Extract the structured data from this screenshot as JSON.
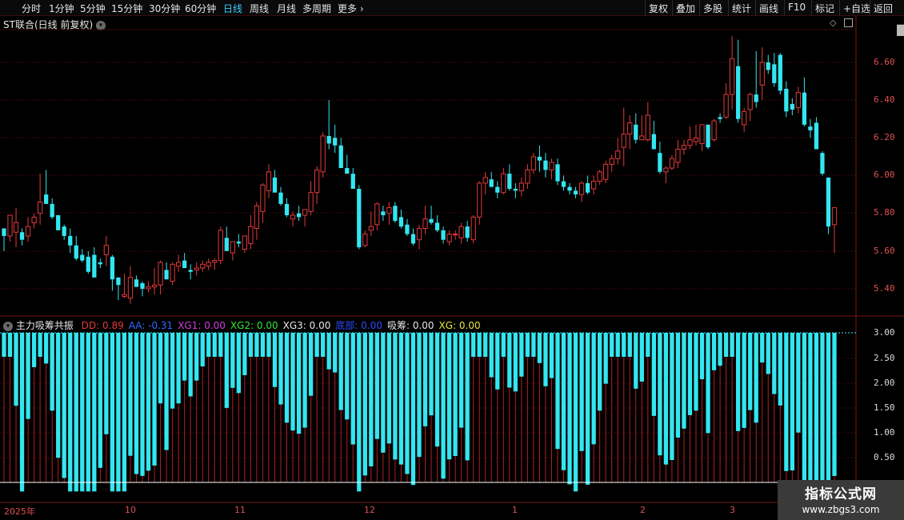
{
  "toolbar": {
    "periods": [
      {
        "label": "分时",
        "active": false
      },
      {
        "label": "1分钟",
        "active": false
      },
      {
        "label": "5分钟",
        "active": false
      },
      {
        "label": "15分钟",
        "active": false
      },
      {
        "label": "30分钟",
        "active": false
      },
      {
        "label": "60分钟",
        "active": false
      },
      {
        "label": "日线",
        "active": true
      },
      {
        "label": "周线",
        "active": false
      },
      {
        "label": "月线",
        "active": false
      },
      {
        "label": "多周期",
        "active": false
      },
      {
        "label": "更多",
        "active": false
      }
    ],
    "right_buttons": [
      "复权",
      "叠加",
      "多股",
      "统计",
      "画线",
      "F10",
      "标记",
      "+自选",
      "返回"
    ]
  },
  "main_chart": {
    "title": "ST联合(日线 前复权)",
    "price_ticks": [
      "6.60",
      "6.40",
      "6.20",
      "6.00",
      "5.80",
      "5.60",
      "5.40"
    ],
    "colors": {
      "up": "#e23a3a",
      "down": "#33e6f0"
    }
  },
  "indicator": {
    "name": "主力吸筹共振",
    "fields": [
      {
        "label": "DD:",
        "value": "0.89",
        "color": "#e23a3a"
      },
      {
        "label": "AA:",
        "value": "-0.31",
        "color": "#2f6bff"
      },
      {
        "label": "XG1:",
        "value": "0.00",
        "color": "#d040e0"
      },
      {
        "label": "XG2:",
        "value": "0.00",
        "color": "#33e633"
      },
      {
        "label": "XG3:",
        "value": "0.00",
        "color": "#e6e6e6"
      },
      {
        "label": "底部:",
        "value": "0.00",
        "color": "#2f4bff"
      },
      {
        "label": "吸筹:",
        "value": "0.00",
        "color": "#e6e6e6"
      },
      {
        "label": "XG:",
        "value": "0.00",
        "color": "#e6e640"
      }
    ],
    "ticks": [
      "3.00",
      "2.50",
      "2.00",
      "1.50",
      "1.00",
      "0.50"
    ]
  },
  "dates": [
    "2025年",
    "10",
    "11",
    "12",
    "1",
    "2",
    "3"
  ],
  "watermark": {
    "title": "指标公式网",
    "url": "www.zbgs3.com"
  },
  "chart_data": {
    "type": "candlestick",
    "series": [
      {
        "values": [
          [
            5.72,
            5.72,
            5.6,
            5.68
          ],
          [
            5.68,
            5.79,
            5.65,
            5.79
          ],
          [
            5.7,
            5.83,
            5.62,
            5.75
          ],
          [
            5.7,
            5.72,
            5.63,
            5.66
          ],
          [
            5.68,
            5.78,
            5.65,
            5.73
          ],
          [
            5.75,
            5.8,
            5.72,
            5.78
          ],
          [
            5.8,
            6.01,
            5.74,
            5.86
          ],
          [
            5.9,
            6.03,
            5.85,
            5.85
          ],
          [
            5.85,
            5.88,
            5.77,
            5.78
          ],
          [
            5.79,
            5.79,
            5.72,
            5.71
          ],
          [
            5.73,
            5.74,
            5.66,
            5.68
          ],
          [
            5.68,
            5.72,
            5.59,
            5.63
          ],
          [
            5.63,
            5.68,
            5.55,
            5.56
          ],
          [
            5.58,
            5.61,
            5.54,
            5.55
          ],
          [
            5.57,
            5.6,
            5.48,
            5.49
          ],
          [
            5.58,
            5.62,
            5.46,
            5.46
          ],
          [
            5.54,
            5.56,
            5.51,
            5.53
          ],
          [
            5.58,
            5.68,
            5.52,
            5.63
          ],
          [
            5.57,
            5.58,
            5.39,
            5.45
          ],
          [
            5.46,
            5.46,
            5.34,
            5.42
          ],
          [
            5.36,
            5.48,
            5.35,
            5.37
          ],
          [
            5.35,
            5.52,
            5.32,
            5.46
          ],
          [
            5.45,
            5.47,
            5.41,
            5.41
          ],
          [
            5.43,
            5.44,
            5.36,
            5.4
          ],
          [
            5.4,
            5.44,
            5.38,
            5.41
          ],
          [
            5.41,
            5.51,
            5.37,
            5.42
          ],
          [
            5.42,
            5.55,
            5.37,
            5.54
          ],
          [
            5.5,
            5.54,
            5.45,
            5.45
          ],
          [
            5.44,
            5.54,
            5.42,
            5.53
          ],
          [
            5.52,
            5.58,
            5.49,
            5.54
          ],
          [
            5.55,
            5.59,
            5.51,
            5.51
          ],
          [
            5.5,
            5.53,
            5.45,
            5.49
          ],
          [
            5.5,
            5.54,
            5.47,
            5.51
          ],
          [
            5.51,
            5.55,
            5.49,
            5.53
          ],
          [
            5.52,
            5.56,
            5.5,
            5.54
          ],
          [
            5.54,
            5.56,
            5.5,
            5.55
          ],
          [
            5.55,
            5.73,
            5.53,
            5.71
          ],
          [
            5.67,
            5.73,
            5.62,
            5.6
          ],
          [
            5.59,
            5.63,
            5.55,
            5.65
          ],
          [
            5.65,
            5.69,
            5.62,
            5.64
          ],
          [
            5.61,
            5.66,
            5.59,
            5.68
          ],
          [
            5.64,
            5.79,
            5.61,
            5.73
          ],
          [
            5.72,
            5.86,
            5.66,
            5.84
          ],
          [
            5.81,
            5.96,
            5.75,
            5.95
          ],
          [
            5.92,
            6.06,
            5.88,
            6.02
          ],
          [
            5.99,
            6.03,
            5.93,
            5.91
          ],
          [
            5.91,
            5.94,
            5.84,
            5.85
          ],
          [
            5.85,
            5.88,
            5.78,
            5.79
          ],
          [
            5.77,
            5.81,
            5.73,
            5.79
          ],
          [
            5.8,
            5.84,
            5.76,
            5.78
          ],
          [
            5.79,
            5.82,
            5.73,
            5.82
          ],
          [
            5.81,
            5.97,
            5.79,
            5.91
          ],
          [
            5.91,
            6.05,
            5.85,
            6.03
          ],
          [
            6.02,
            6.23,
            5.99,
            6.21
          ],
          [
            6.21,
            6.4,
            6.14,
            6.17
          ],
          [
            6.2,
            6.27,
            6.12,
            6.16
          ],
          [
            6.16,
            6.2,
            6.04,
            6.04
          ],
          [
            6.04,
            6.11,
            6.01,
            6.01
          ],
          [
            6.01,
            6.04,
            5.93,
            5.93
          ],
          [
            5.93,
            5.95,
            5.61,
            5.62
          ],
          [
            5.63,
            5.71,
            5.62,
            5.69
          ],
          [
            5.71,
            5.81,
            5.68,
            5.73
          ],
          [
            5.74,
            5.86,
            5.71,
            5.85
          ],
          [
            5.81,
            5.84,
            5.76,
            5.79
          ],
          [
            5.8,
            5.86,
            5.74,
            5.83
          ],
          [
            5.84,
            5.86,
            5.75,
            5.76
          ],
          [
            5.78,
            5.82,
            5.72,
            5.73
          ],
          [
            5.74,
            5.77,
            5.68,
            5.69
          ],
          [
            5.69,
            5.72,
            5.63,
            5.64
          ],
          [
            5.66,
            5.74,
            5.61,
            5.72
          ],
          [
            5.72,
            5.84,
            5.69,
            5.77
          ],
          [
            5.77,
            5.84,
            5.74,
            5.75
          ],
          [
            5.75,
            5.79,
            5.7,
            5.71
          ],
          [
            5.71,
            5.73,
            5.64,
            5.66
          ],
          [
            5.65,
            5.71,
            5.63,
            5.69
          ],
          [
            5.69,
            5.71,
            5.66,
            5.69
          ],
          [
            5.67,
            5.75,
            5.64,
            5.73
          ],
          [
            5.73,
            5.76,
            5.65,
            5.67
          ],
          [
            5.66,
            5.79,
            5.64,
            5.78
          ],
          [
            5.78,
            5.97,
            5.74,
            5.96
          ],
          [
            5.96,
            6.02,
            5.9,
            5.99
          ],
          [
            5.98,
            6.02,
            5.94,
            5.94
          ],
          [
            5.94,
            5.97,
            5.88,
            5.91
          ],
          [
            5.91,
            6.04,
            5.9,
            6.01
          ],
          [
            6.01,
            6.06,
            5.92,
            5.93
          ],
          [
            5.93,
            5.96,
            5.88,
            5.92
          ],
          [
            5.92,
            5.99,
            5.89,
            5.96
          ],
          [
            5.96,
            6.06,
            5.93,
            6.03
          ],
          [
            6.03,
            6.12,
            6.01,
            6.1
          ],
          [
            6.1,
            6.16,
            6.02,
            6.08
          ],
          [
            6.08,
            6.12,
            5.99,
            6.03
          ],
          [
            6.03,
            6.09,
            5.98,
            6.07
          ],
          [
            6.06,
            6.09,
            5.95,
            5.97
          ],
          [
            5.97,
            6.0,
            5.92,
            5.94
          ],
          [
            5.94,
            5.96,
            5.9,
            5.92
          ],
          [
            5.92,
            5.94,
            5.88,
            5.9
          ],
          [
            5.9,
            5.97,
            5.86,
            5.96
          ],
          [
            5.96,
            6.0,
            5.9,
            5.91
          ],
          [
            5.93,
            6.0,
            5.9,
            5.97
          ],
          [
            5.97,
            6.03,
            5.95,
            6.02
          ],
          [
            5.98,
            6.08,
            5.96,
            6.06
          ],
          [
            6.06,
            6.11,
            6.02,
            6.09
          ],
          [
            6.09,
            6.2,
            6.06,
            6.13
          ],
          [
            6.15,
            6.36,
            6.05,
            6.22
          ],
          [
            6.22,
            6.32,
            6.14,
            6.28
          ],
          [
            6.27,
            6.33,
            6.17,
            6.19
          ],
          [
            6.19,
            6.32,
            6.19,
            6.21
          ],
          [
            6.19,
            6.39,
            6.18,
            6.32
          ],
          [
            6.22,
            6.29,
            6.14,
            6.14
          ],
          [
            6.12,
            6.18,
            6.01,
            6.02
          ],
          [
            6.02,
            6.05,
            5.96,
            6.04
          ],
          [
            6.04,
            6.11,
            6.03,
            6.09
          ],
          [
            6.07,
            6.19,
            6.04,
            6.14
          ],
          [
            6.14,
            6.19,
            6.11,
            6.16
          ],
          [
            6.16,
            6.26,
            6.14,
            6.19
          ],
          [
            6.18,
            6.27,
            6.16,
            6.2
          ],
          [
            6.17,
            6.26,
            6.13,
            6.27
          ],
          [
            6.27,
            6.27,
            6.14,
            6.15
          ],
          [
            6.19,
            6.3,
            6.18,
            6.29
          ],
          [
            6.31,
            6.33,
            6.28,
            6.3
          ],
          [
            6.31,
            6.49,
            6.3,
            6.43
          ],
          [
            6.43,
            6.74,
            6.35,
            6.62
          ],
          [
            6.58,
            6.72,
            6.28,
            6.3
          ],
          [
            6.27,
            6.36,
            6.23,
            6.34
          ],
          [
            6.35,
            6.44,
            6.29,
            6.43
          ],
          [
            6.43,
            6.66,
            6.36,
            6.39
          ],
          [
            6.48,
            6.68,
            6.4,
            6.6
          ],
          [
            6.6,
            6.64,
            6.54,
            6.56
          ],
          [
            6.59,
            6.65,
            6.47,
            6.49
          ],
          [
            6.64,
            6.65,
            6.43,
            6.45
          ],
          [
            6.46,
            6.5,
            6.31,
            6.34
          ],
          [
            6.38,
            6.41,
            6.32,
            6.35
          ],
          [
            6.36,
            6.47,
            6.33,
            6.44
          ],
          [
            6.44,
            6.52,
            6.26,
            6.27
          ],
          [
            6.26,
            6.3,
            6.2,
            6.24
          ],
          [
            6.28,
            6.31,
            6.22,
            6.14
          ],
          [
            6.12,
            6.13,
            6.0,
            6.01
          ],
          [
            5.99,
            5.97,
            5.69,
            5.73
          ],
          [
            5.74,
            5.82,
            5.59,
            5.83
          ]
        ]
      }
    ]
  }
}
